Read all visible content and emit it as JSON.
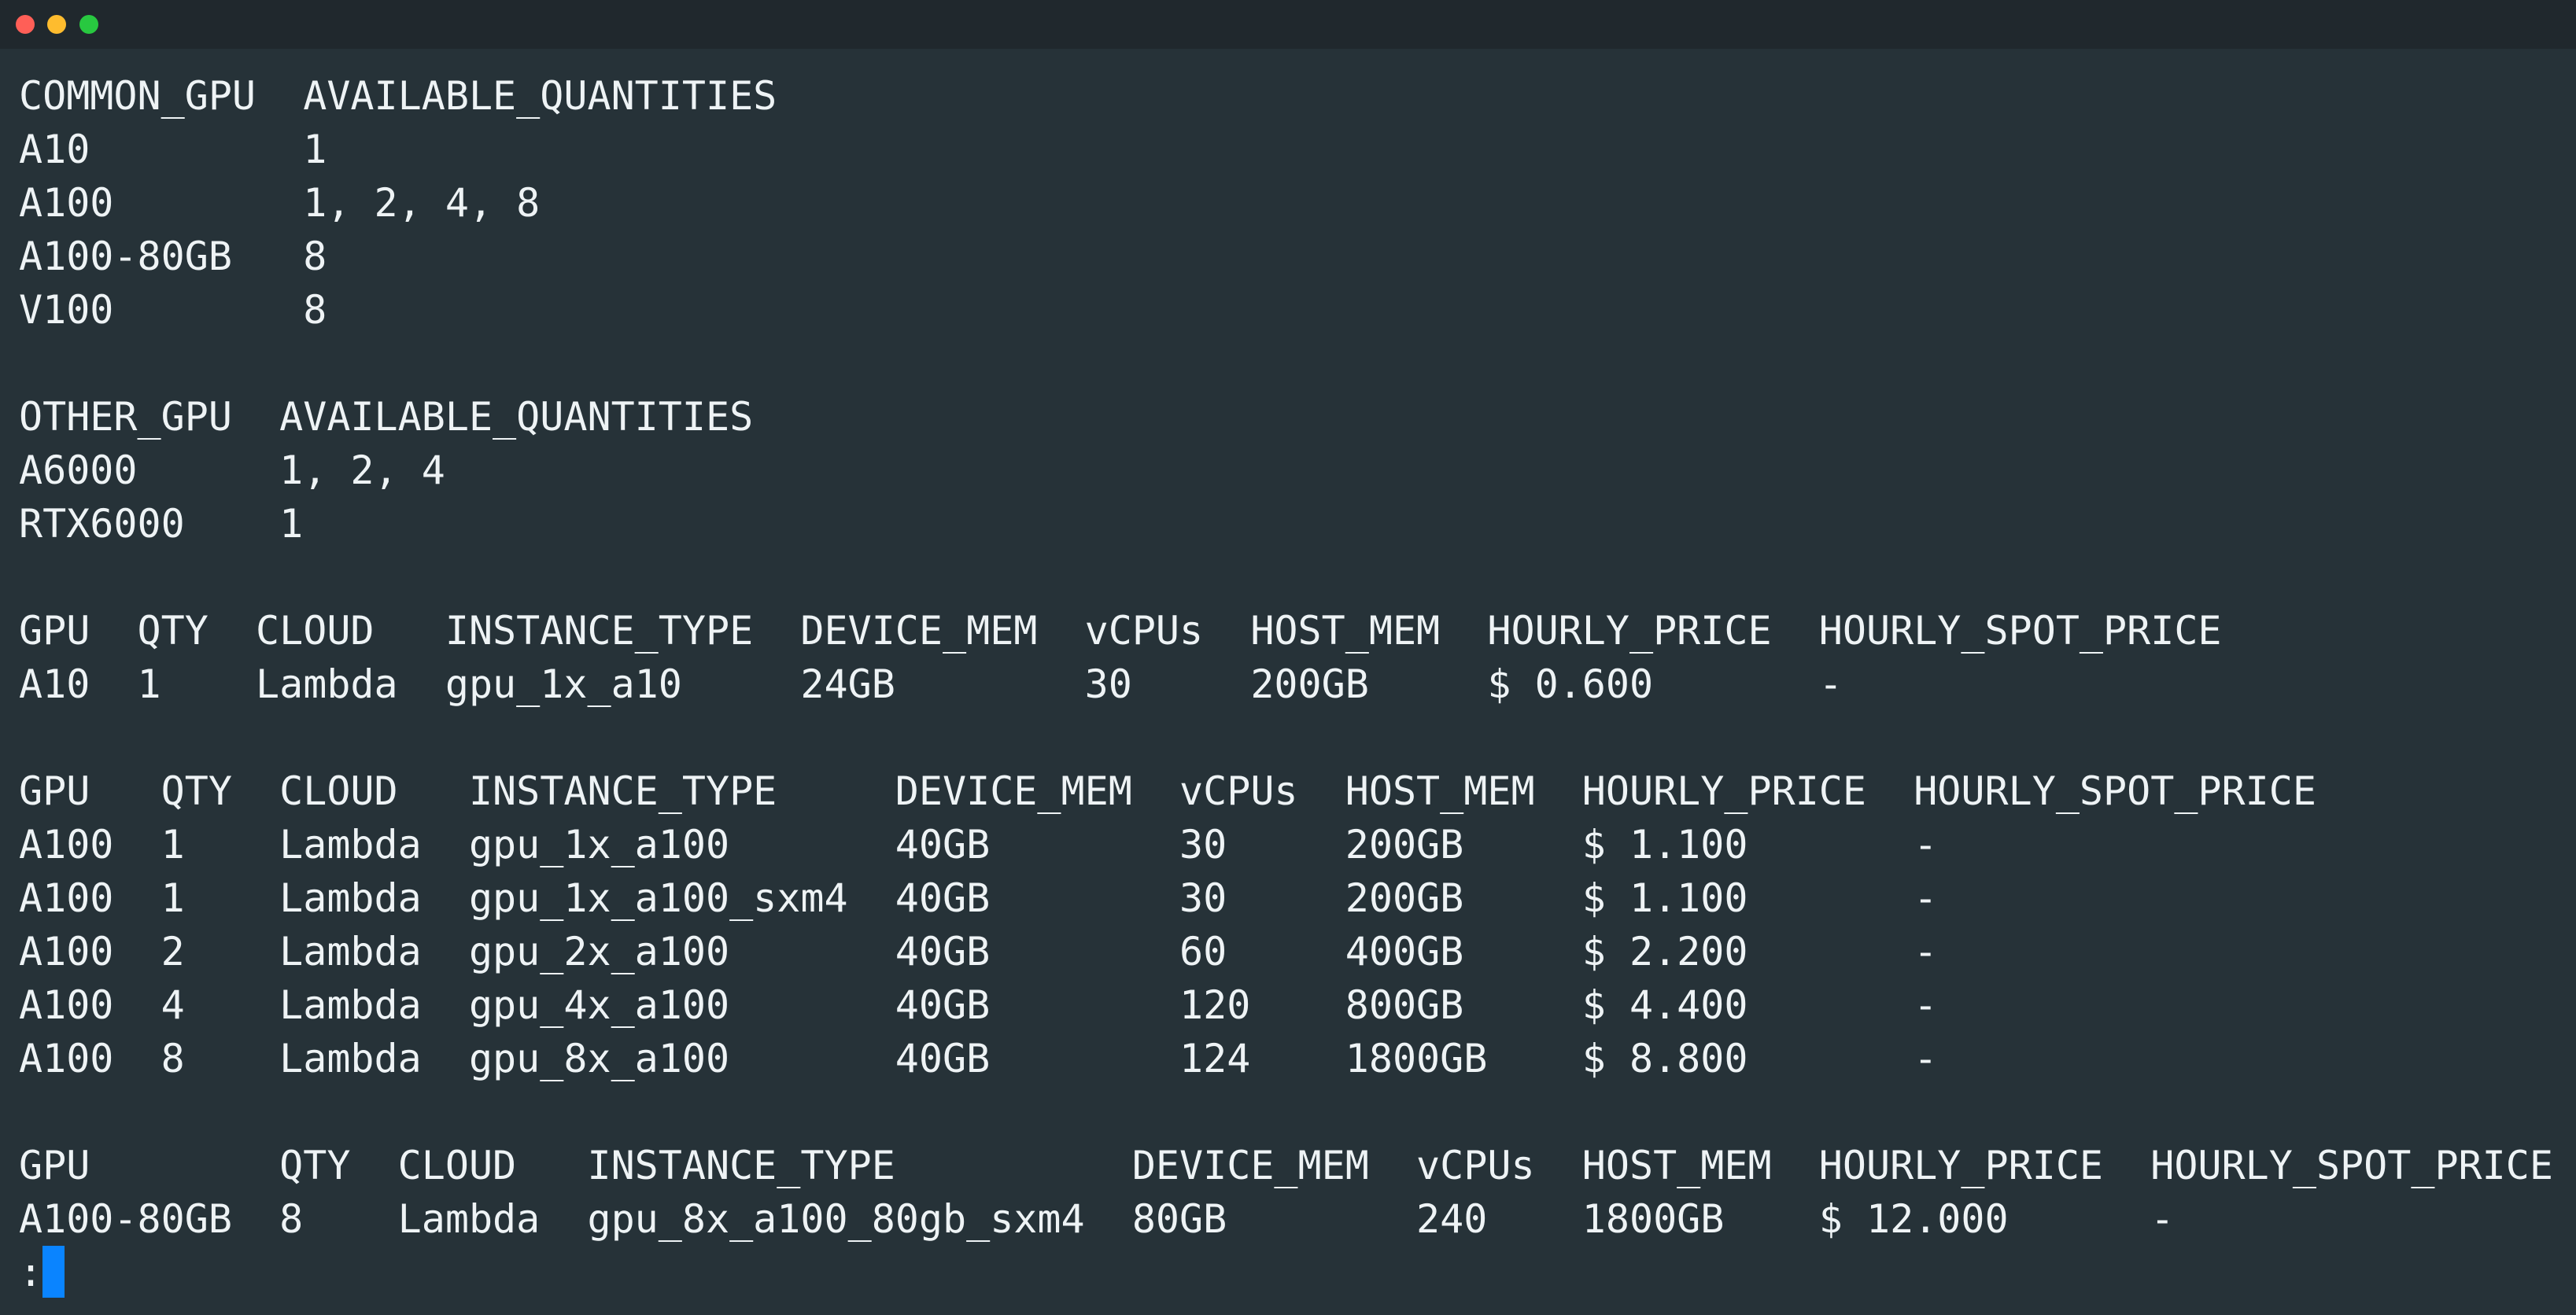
{
  "window": {
    "controls": [
      {
        "name": "close",
        "color": "#ff5f57"
      },
      {
        "name": "minimize",
        "color": "#febc2e"
      },
      {
        "name": "zoom",
        "color": "#28c840"
      }
    ]
  },
  "terminal": {
    "lines": [
      "COMMON_GPU  AVAILABLE_QUANTITIES",
      "A10         1",
      "A100        1, 2, 4, 8",
      "A100-80GB   8",
      "V100        8",
      "",
      "OTHER_GPU  AVAILABLE_QUANTITIES",
      "A6000      1, 2, 4",
      "RTX6000    1",
      "",
      "GPU  QTY  CLOUD   INSTANCE_TYPE  DEVICE_MEM  vCPUs  HOST_MEM  HOURLY_PRICE  HOURLY_SPOT_PRICE",
      "A10  1    Lambda  gpu_1x_a10     24GB        30     200GB     $ 0.600       -",
      "",
      "GPU   QTY  CLOUD   INSTANCE_TYPE     DEVICE_MEM  vCPUs  HOST_MEM  HOURLY_PRICE  HOURLY_SPOT_PRICE",
      "A100  1    Lambda  gpu_1x_a100       40GB        30     200GB     $ 1.100       -",
      "A100  1    Lambda  gpu_1x_a100_sxm4  40GB        30     200GB     $ 1.100       -",
      "A100  2    Lambda  gpu_2x_a100       40GB        60     400GB     $ 2.200       -",
      "A100  4    Lambda  gpu_4x_a100       40GB        120    800GB     $ 4.400       -",
      "A100  8    Lambda  gpu_8x_a100       40GB        124    1800GB    $ 8.800       -",
      "",
      "GPU        QTY  CLOUD   INSTANCE_TYPE          DEVICE_MEM  vCPUs  HOST_MEM  HOURLY_PRICE  HOURLY_SPOT_PRICE",
      "A100-80GB  8    Lambda  gpu_8x_a100_80gb_sxm4  80GB        240    1800GB    $ 12.000      -"
    ],
    "prompt": ":"
  }
}
